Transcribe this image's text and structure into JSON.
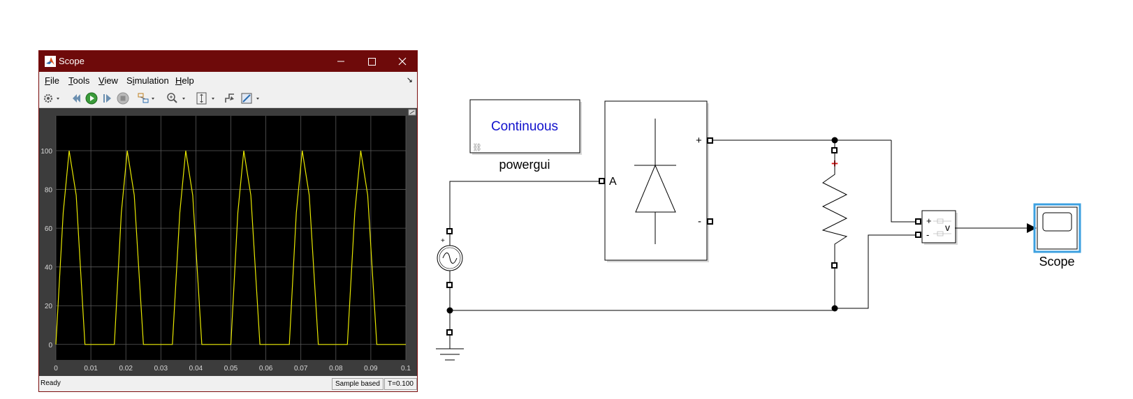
{
  "scope_window": {
    "title": "Scope",
    "menu": [
      {
        "key": "F",
        "rest": "ile"
      },
      {
        "key": "T",
        "rest": "ools"
      },
      {
        "key": "V",
        "rest": "iew"
      },
      {
        "pre": "S",
        "key": "i",
        "rest": "mulation"
      },
      {
        "key": "H",
        "rest": "elp"
      }
    ],
    "menu_overflow": "↘",
    "status": {
      "ready": "Ready",
      "mode": "Sample based",
      "time": "T=0.100"
    }
  },
  "chart_data": {
    "type": "line",
    "xlim": [
      0,
      0.1
    ],
    "ylim": [
      -8,
      118
    ],
    "xticks": [
      0,
      0.01,
      0.02,
      0.03,
      0.04,
      0.05,
      0.06,
      0.07,
      0.08,
      0.09,
      0.1
    ],
    "xtick_labels": [
      "0",
      "0.01",
      "0.02",
      "0.03",
      "0.04",
      "0.05",
      "0.06",
      "0.07",
      "0.08",
      "0.09",
      "0.1"
    ],
    "yticks": [
      0,
      20,
      40,
      60,
      80,
      100
    ],
    "ytick_labels": [
      "0",
      "20",
      "40",
      "60",
      "80",
      "100"
    ],
    "grid": true,
    "colors": {
      "background": "#000000",
      "frame": "#3c3c3c",
      "grid": "#5a5a5a",
      "line": "#e8e800",
      "ticks": "#d8d8d8"
    },
    "series": [
      {
        "x": [
          0,
          0.0021,
          0.0038,
          0.0058,
          0.0083,
          0.0167,
          0.0187,
          0.0204,
          0.0224,
          0.025,
          0.0333,
          0.0354,
          0.0371,
          0.0391,
          0.0417,
          0.05,
          0.052,
          0.0537,
          0.0557,
          0.0583,
          0.0667,
          0.0687,
          0.0704,
          0.0724,
          0.075,
          0.0833,
          0.0854,
          0.0871,
          0.0891,
          0.0917,
          0.1
        ],
        "y": [
          0,
          68,
          100,
          77,
          0,
          0,
          68,
          100,
          77,
          0,
          0,
          68,
          100,
          77,
          0,
          0,
          68,
          100,
          77,
          0,
          0,
          68,
          100,
          77,
          0,
          0,
          68,
          100,
          77,
          0,
          0
        ]
      }
    ]
  },
  "diagram": {
    "powergui_block_text": "Continuous",
    "powergui_label": "powergui",
    "diode_port_a": "A",
    "diode_port_plus": "+",
    "diode_port_minus": "-",
    "source_port": "+",
    "resistor_port": "+",
    "vm_plus": "+",
    "vm_minus": "-",
    "vm_v": "v",
    "scope_label": "Scope",
    "colors": {
      "powergui_text": "#1010cc",
      "scope_highlight": "#3ca0e0",
      "polarity": "#e01010"
    }
  }
}
